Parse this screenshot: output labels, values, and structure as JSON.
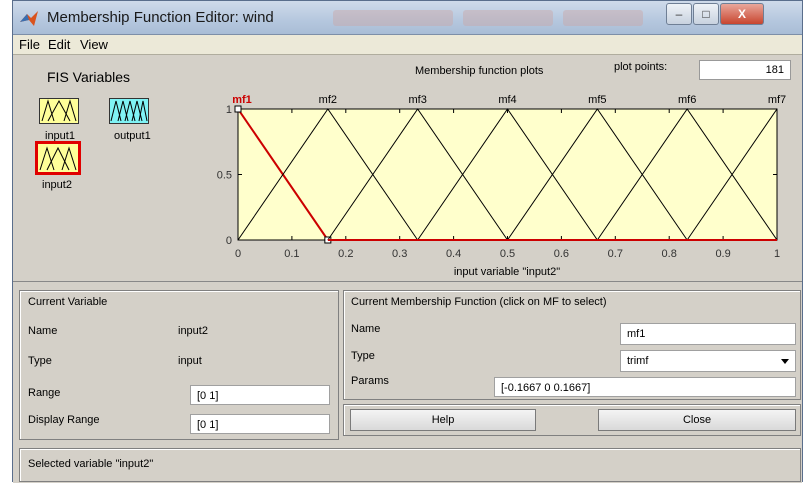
{
  "window": {
    "title": "Membership Function Editor: wind",
    "controls": {
      "minimize": "–",
      "maximize": "□",
      "close": "X"
    }
  },
  "menu": [
    "File",
    "Edit",
    "View"
  ],
  "fis": {
    "title": "FIS Variables",
    "variables": [
      {
        "name": "input1",
        "kind": "input"
      },
      {
        "name": "output1",
        "kind": "output"
      },
      {
        "name": "input2",
        "kind": "input",
        "selected": true
      }
    ]
  },
  "plot": {
    "title": "Membership function plots",
    "plot_points_label": "plot points:",
    "plot_points_value": "181",
    "xlabel": "input variable \"input2\""
  },
  "chart_data": {
    "type": "line",
    "x_range": [
      0,
      1
    ],
    "y_range": [
      0,
      1
    ],
    "x_ticks": [
      "0",
      "0.1",
      "0.2",
      "0.3",
      "0.4",
      "0.5",
      "0.6",
      "0.7",
      "0.8",
      "0.9",
      "1"
    ],
    "y_ticks": [
      "0",
      "0.5",
      "1"
    ],
    "selected_index": 0,
    "selected_color": "#cc0000",
    "series": [
      {
        "name": "mf1",
        "x": [
          -0.1667,
          0,
          0.1667
        ],
        "y": [
          0,
          1,
          0
        ]
      },
      {
        "name": "mf2",
        "x": [
          0,
          0.1667,
          0.3333
        ],
        "y": [
          0,
          1,
          0
        ]
      },
      {
        "name": "mf3",
        "x": [
          0.1667,
          0.3333,
          0.5
        ],
        "y": [
          0,
          1,
          0
        ]
      },
      {
        "name": "mf4",
        "x": [
          0.3333,
          0.5,
          0.6667
        ],
        "y": [
          0,
          1,
          0
        ]
      },
      {
        "name": "mf5",
        "x": [
          0.5,
          0.6667,
          0.8333
        ],
        "y": [
          0,
          1,
          0
        ]
      },
      {
        "name": "mf6",
        "x": [
          0.6667,
          0.8333,
          1
        ],
        "y": [
          0,
          1,
          0
        ]
      },
      {
        "name": "mf7",
        "x": [
          0.8333,
          1,
          1.1667
        ],
        "y": [
          0,
          1,
          0
        ]
      }
    ]
  },
  "current_variable": {
    "title": "Current Variable",
    "name_label": "Name",
    "name_value": "input2",
    "type_label": "Type",
    "type_value": "input",
    "range_label": "Range",
    "range_value": "[0 1]",
    "display_range_label": "Display Range",
    "display_range_value": "[0 1]"
  },
  "current_mf": {
    "title": "Current Membership Function (click on MF to select)",
    "name_label": "Name",
    "name_value": "mf1",
    "type_label": "Type",
    "type_value": "trimf",
    "params_label": "Params",
    "params_value": "[-0.1667 0 0.1667]"
  },
  "buttons": {
    "help": "Help",
    "close": "Close"
  },
  "status": "Selected variable \"input2\""
}
